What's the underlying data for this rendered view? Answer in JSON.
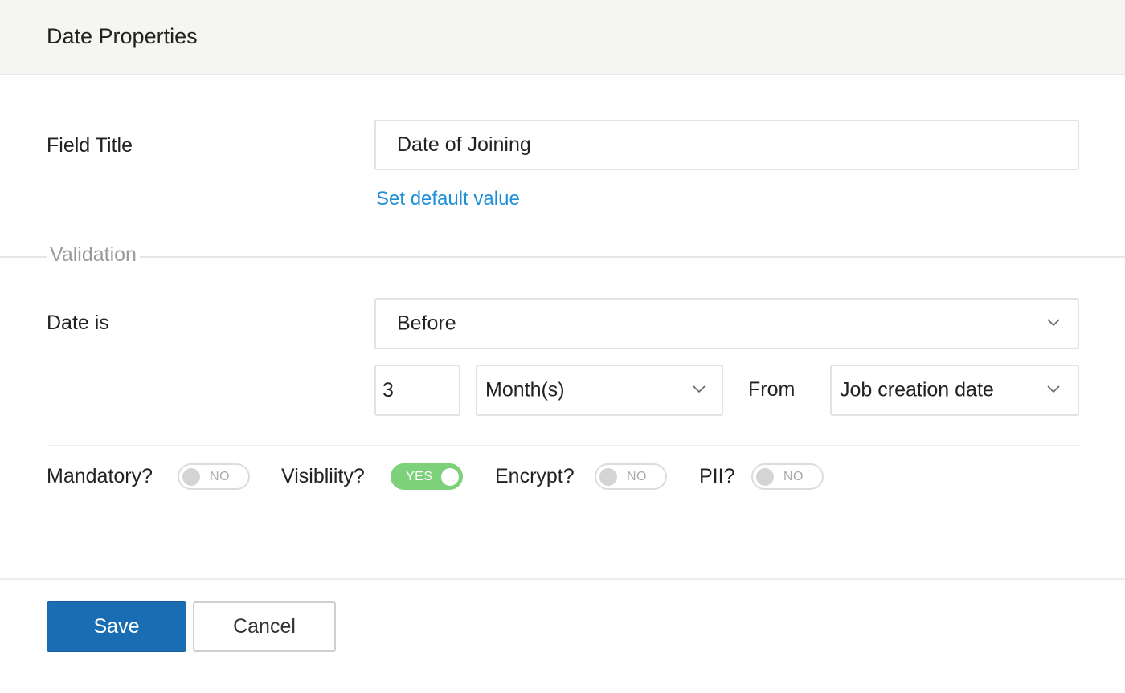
{
  "header": {
    "title": "Date Properties"
  },
  "field_title": {
    "label": "Field Title",
    "value": "Date of Joining",
    "set_default_link": "Set default value"
  },
  "validation": {
    "legend": "Validation",
    "date_is": {
      "label": "Date is",
      "condition": "Before",
      "amount": "3",
      "unit": "Month(s)",
      "from_label": "From",
      "reference": "Job creation date"
    }
  },
  "toggles": [
    {
      "label": "Mandatory?",
      "state": "NO",
      "on": false
    },
    {
      "label": "Visibliity?",
      "state": "YES",
      "on": true
    },
    {
      "label": "Encrypt?",
      "state": "NO",
      "on": false
    },
    {
      "label": "PII?",
      "state": "NO",
      "on": false
    }
  ],
  "footer": {
    "save_label": "Save",
    "cancel_label": "Cancel"
  },
  "colors": {
    "link": "#1e90d8",
    "primary_button": "#1b6db3",
    "toggle_on": "#7ed17b",
    "header_bg": "#f5f5f2"
  },
  "icons": {
    "dropdown": "chevron-down-icon"
  }
}
